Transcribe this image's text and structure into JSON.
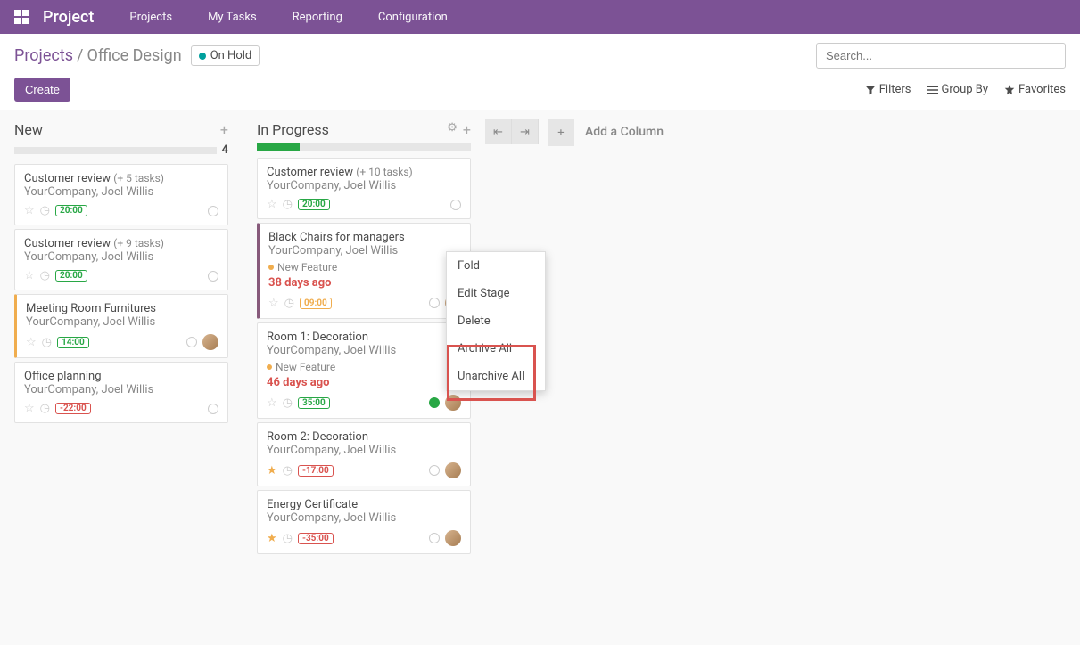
{
  "nav": {
    "brand": "Project",
    "items": [
      "Projects",
      "My Tasks",
      "Reporting",
      "Configuration"
    ]
  },
  "breadcrumb": {
    "parent": "Projects",
    "current": "Office Design"
  },
  "status": {
    "label": "On Hold"
  },
  "search": {
    "placeholder": "Search..."
  },
  "filters": {
    "filters": "Filters",
    "groupby": "Group By",
    "favorites": "Favorites"
  },
  "create": "Create",
  "addColumn": "Add a Column",
  "columns": [
    {
      "title": "New",
      "count": "4",
      "progress": 0,
      "cards": [
        {
          "title": "Customer review",
          "subtasks": "(+ 5 tasks)",
          "subtitle": "YourCompany, Joel Willis",
          "pill": "20:00",
          "pillClass": "green",
          "leftbar": "",
          "star": false
        },
        {
          "title": "Customer review",
          "subtasks": "(+ 9 tasks)",
          "subtitle": "YourCompany, Joel Willis",
          "pill": "20:00",
          "pillClass": "green",
          "leftbar": "",
          "star": false
        },
        {
          "title": "Meeting Room Furnitures",
          "subtitle": "YourCompany, Joel Willis",
          "pill": "14:00",
          "pillClass": "green",
          "leftbar": "yellow",
          "star": false,
          "avatar": true
        },
        {
          "title": "Office planning",
          "subtitle": "YourCompany, Joel Willis",
          "pill": "-22:00",
          "pillClass": "red",
          "leftbar": "",
          "star": false
        }
      ]
    },
    {
      "title": "In Progress",
      "count": "",
      "progress": 20,
      "cards": [
        {
          "title": "Customer review",
          "subtasks": "(+ 10 tasks)",
          "subtitle": "YourCompany, Joel Willis",
          "pill": "20:00",
          "pillClass": "green",
          "leftbar": "",
          "star": false
        },
        {
          "title": "Black Chairs for managers",
          "subtitle": "YourCompany, Joel Willis",
          "tag": "New Feature",
          "overdue": "38 days ago",
          "pill": "09:00",
          "pillClass": "yellow",
          "leftbar": "purple",
          "star": false,
          "avatar": true
        },
        {
          "title": "Room 1: Decoration",
          "subtitle": "YourCompany, Joel Willis",
          "tag": "New Feature",
          "overdue": "46 days ago",
          "pill": "35:00",
          "pillClass": "green",
          "leftbar": "",
          "star": false,
          "avatar": true,
          "greenCircle": true
        },
        {
          "title": "Room 2: Decoration",
          "subtitle": "YourCompany, Joel Willis",
          "pill": "-17:00",
          "pillClass": "red",
          "leftbar": "",
          "star": true,
          "avatar": true
        },
        {
          "title": "Energy Certificate",
          "subtitle": "YourCompany, Joel Willis",
          "pill": "-35:00",
          "pillClass": "red",
          "leftbar": "",
          "star": true,
          "avatar": true
        }
      ]
    }
  ],
  "dropdown": {
    "items": [
      "Fold",
      "Edit Stage",
      "Delete",
      "Archive All",
      "Unarchive All"
    ]
  }
}
